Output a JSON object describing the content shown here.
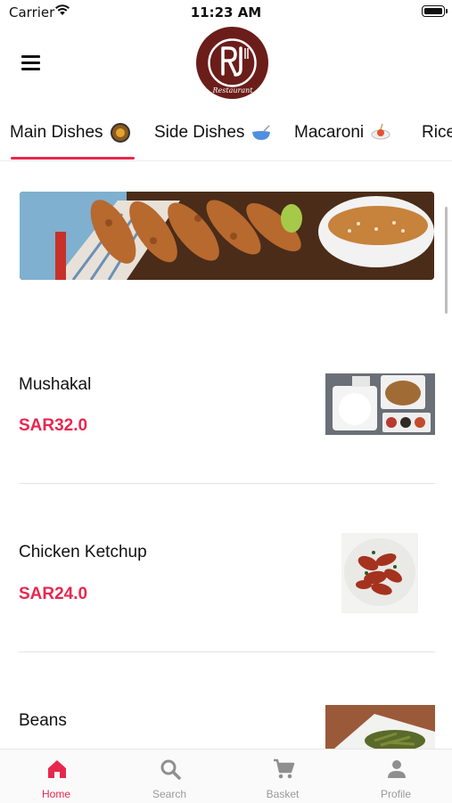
{
  "status_bar": {
    "carrier": "Carrier",
    "time": "11:23 AM"
  },
  "header": {
    "logo_monogram": "RJ",
    "logo_text": "Restaurant"
  },
  "tabs": [
    {
      "label": "Main Dishes",
      "icon": "paella-icon",
      "active": true
    },
    {
      "label": "Side Dishes",
      "icon": "bowl-icon",
      "active": false
    },
    {
      "label": "Macaroni",
      "icon": "pasta-icon",
      "active": false
    },
    {
      "label": "Rice",
      "icon": "",
      "active": false
    }
  ],
  "menu_items": [
    {
      "name": "Mushakal",
      "price": "SAR32.0",
      "image": "mushakal-platter"
    },
    {
      "name": "Chicken Ketchup",
      "price": "SAR24.0",
      "image": "chicken-ketchup-plate"
    },
    {
      "name": "Beans",
      "price": "",
      "image": "beans-plate"
    }
  ],
  "bottom_nav": [
    {
      "label": "Home",
      "icon": "home-icon",
      "active": true
    },
    {
      "label": "Search",
      "icon": "search-icon",
      "active": false
    },
    {
      "label": "Basket",
      "icon": "cart-icon",
      "active": false
    },
    {
      "label": "Profile",
      "icon": "person-icon",
      "active": false
    }
  ],
  "colors": {
    "accent": "#e8274f",
    "logo_bg": "#6b1d1a",
    "inactive": "#9a9a9a"
  }
}
